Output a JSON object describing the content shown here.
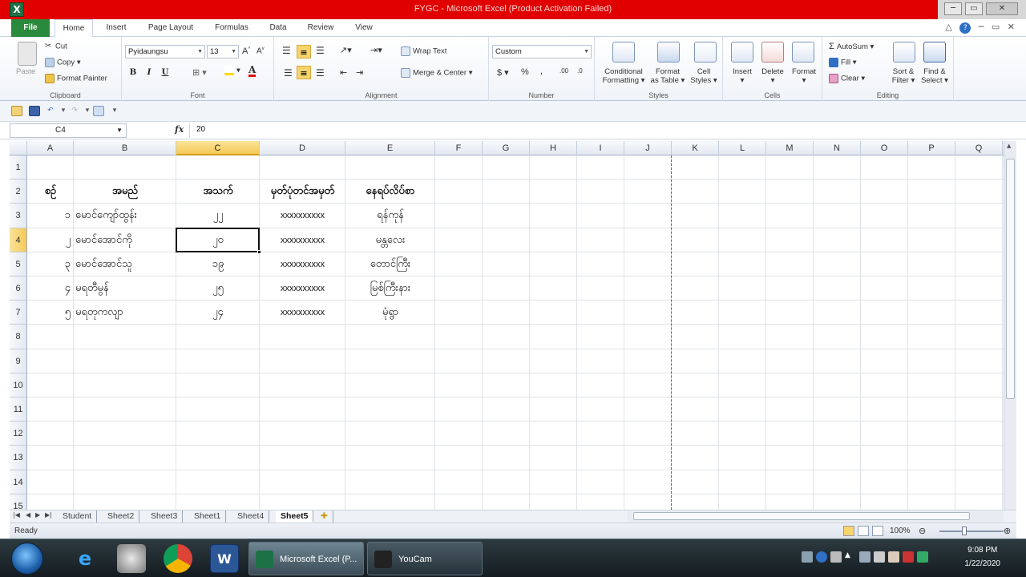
{
  "window": {
    "title": "FYGC - Microsoft Excel (Product Activation Failed)",
    "app_icon": "X"
  },
  "tabs": [
    "File",
    "Home",
    "Insert",
    "Page Layout",
    "Formulas",
    "Data",
    "Review",
    "View"
  ],
  "ribbon": {
    "clipboard": {
      "label": "Clipboard",
      "paste": "Paste",
      "cut": "Cut",
      "copy": "Copy",
      "format_painter": "Format Painter"
    },
    "font": {
      "label": "Font",
      "name": "Pyidaungsu",
      "size": "13",
      "bold": "B",
      "italic": "I",
      "underline": "U"
    },
    "alignment": {
      "label": "Alignment",
      "wrap_text": "Wrap Text",
      "merge_center": "Merge & Center"
    },
    "number": {
      "label": "Number",
      "format": "Custom",
      "currency": "$",
      "percent": "%",
      "comma": ",",
      "inc_decimal": ".00",
      "dec_decimal": ".0"
    },
    "styles": {
      "label": "Styles",
      "conditional_1": "Conditional",
      "conditional_2": "Formatting",
      "format_table_1": "Format",
      "format_table_2": "as Table",
      "cell_styles_1": "Cell",
      "cell_styles_2": "Styles"
    },
    "cells": {
      "label": "Cells",
      "insert": "Insert",
      "delete": "Delete",
      "format": "Format"
    },
    "editing": {
      "label": "Editing",
      "autosum": "AutoSum",
      "fill": "Fill",
      "clear": "Clear",
      "sort_1": "Sort &",
      "sort_2": "Filter",
      "find_1": "Find &",
      "find_2": "Select"
    }
  },
  "formula_bar": {
    "name_box": "C4",
    "fx": "fx",
    "value": "20"
  },
  "grid": {
    "columns": [
      "A",
      "B",
      "C",
      "D",
      "E",
      "F",
      "G",
      "H",
      "I",
      "J",
      "K",
      "L",
      "M",
      "N",
      "O",
      "P",
      "Q"
    ],
    "rows": [
      "1",
      "2",
      "3",
      "4",
      "5",
      "6",
      "7",
      "8",
      "9",
      "10",
      "11",
      "12",
      "13",
      "14",
      "15"
    ],
    "selected_column": "C",
    "selected_row": "4",
    "header_row": {
      "A": "စဉ်",
      "B": "အမည်",
      "C": "အသက်",
      "D": "မှတ်ပုံတင်အမှတ်",
      "E": "နေရပ်လိပ်စာ"
    },
    "data_rows": [
      {
        "A": "၁",
        "B": "မောင်ကျော်ထွန်း",
        "C": "၂၂",
        "D": "xxxxxxxxxx",
        "E": "ရန်ကုန်"
      },
      {
        "A": "၂",
        "B": "မောင်အောင်ကို",
        "C": "၂၀",
        "D": "xxxxxxxxxx",
        "E": "မန္တလေး"
      },
      {
        "A": "၃",
        "B": "မောင်အောင်သူ",
        "C": "၁၉",
        "D": "xxxxxxxxxx",
        "E": "တောင်ကြီး"
      },
      {
        "A": "၄",
        "B": "မရတီမွန်",
        "C": "၂၅",
        "D": "xxxxxxxxxx",
        "E": "မြစ်ကြီးနား"
      },
      {
        "A": "၅",
        "B": "မရတုကလျာ",
        "C": "၂၄",
        "D": "xxxxxxxxxx",
        "E": "မုံရွာ"
      }
    ]
  },
  "sheets": [
    "Student",
    "Sheet2",
    "Sheet3",
    "Sheet1",
    "Sheet4",
    "Sheet5"
  ],
  "active_sheet": "Sheet5",
  "status": {
    "ready": "Ready",
    "zoom": "100%"
  },
  "taskbar": {
    "tasks": [
      {
        "label": "Microsoft Excel (P...",
        "active": true
      },
      {
        "label": "YouCam",
        "active": false
      }
    ],
    "time": "9:08 PM",
    "date": "1/22/2020"
  },
  "colors": {
    "titlebar": "#e00000",
    "file_tab": "#2a8a3c",
    "selection": "#f5c955"
  }
}
